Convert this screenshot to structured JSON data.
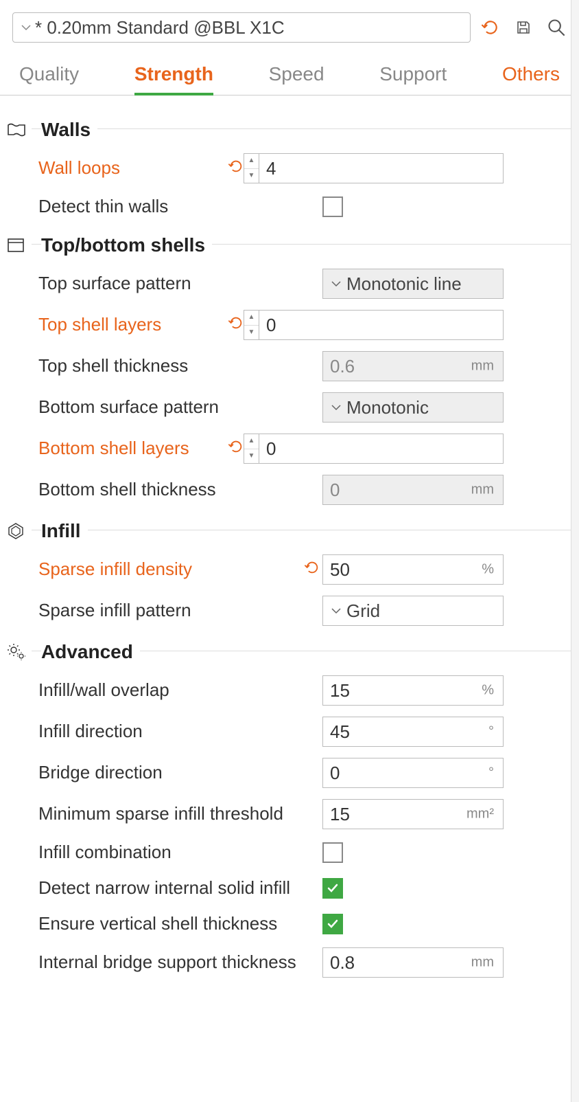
{
  "preset": {
    "label": "* 0.20mm Standard @BBL X1C"
  },
  "tabs": {
    "quality": "Quality",
    "strength": "Strength",
    "speed": "Speed",
    "support": "Support",
    "others": "Others"
  },
  "sections": {
    "walls": {
      "title": "Walls",
      "wall_loops": {
        "label": "Wall loops",
        "value": "4"
      },
      "detect_thin_walls": {
        "label": "Detect thin walls"
      }
    },
    "topbottom": {
      "title": "Top/bottom shells",
      "top_surface_pattern": {
        "label": "Top surface pattern",
        "value": "Monotonic line"
      },
      "top_shell_layers": {
        "label": "Top shell layers",
        "value": "0"
      },
      "top_shell_thickness": {
        "label": "Top shell thickness",
        "value": "0.6",
        "unit": "mm"
      },
      "bottom_surface_pattern": {
        "label": "Bottom surface pattern",
        "value": "Monotonic"
      },
      "bottom_shell_layers": {
        "label": "Bottom shell layers",
        "value": "0"
      },
      "bottom_shell_thickness": {
        "label": "Bottom shell thickness",
        "value": "0",
        "unit": "mm"
      }
    },
    "infill": {
      "title": "Infill",
      "sparse_infill_density": {
        "label": "Sparse infill density",
        "value": "50",
        "unit": "%"
      },
      "sparse_infill_pattern": {
        "label": "Sparse infill pattern",
        "value": "Grid"
      }
    },
    "advanced": {
      "title": "Advanced",
      "infill_wall_overlap": {
        "label": "Infill/wall overlap",
        "value": "15",
        "unit": "%"
      },
      "infill_direction": {
        "label": "Infill direction",
        "value": "45",
        "unit": "°"
      },
      "bridge_direction": {
        "label": "Bridge direction",
        "value": "0",
        "unit": "°"
      },
      "min_sparse_infill_threshold": {
        "label": "Minimum sparse infill threshold",
        "value": "15",
        "unit": "mm²"
      },
      "infill_combination": {
        "label": "Infill combination"
      },
      "detect_narrow_internal": {
        "label": "Detect narrow internal solid infill"
      },
      "ensure_vertical_shell": {
        "label": "Ensure vertical shell thickness"
      },
      "internal_bridge_support": {
        "label": "Internal bridge support thickness",
        "value": "0.8",
        "unit": "mm"
      }
    }
  }
}
